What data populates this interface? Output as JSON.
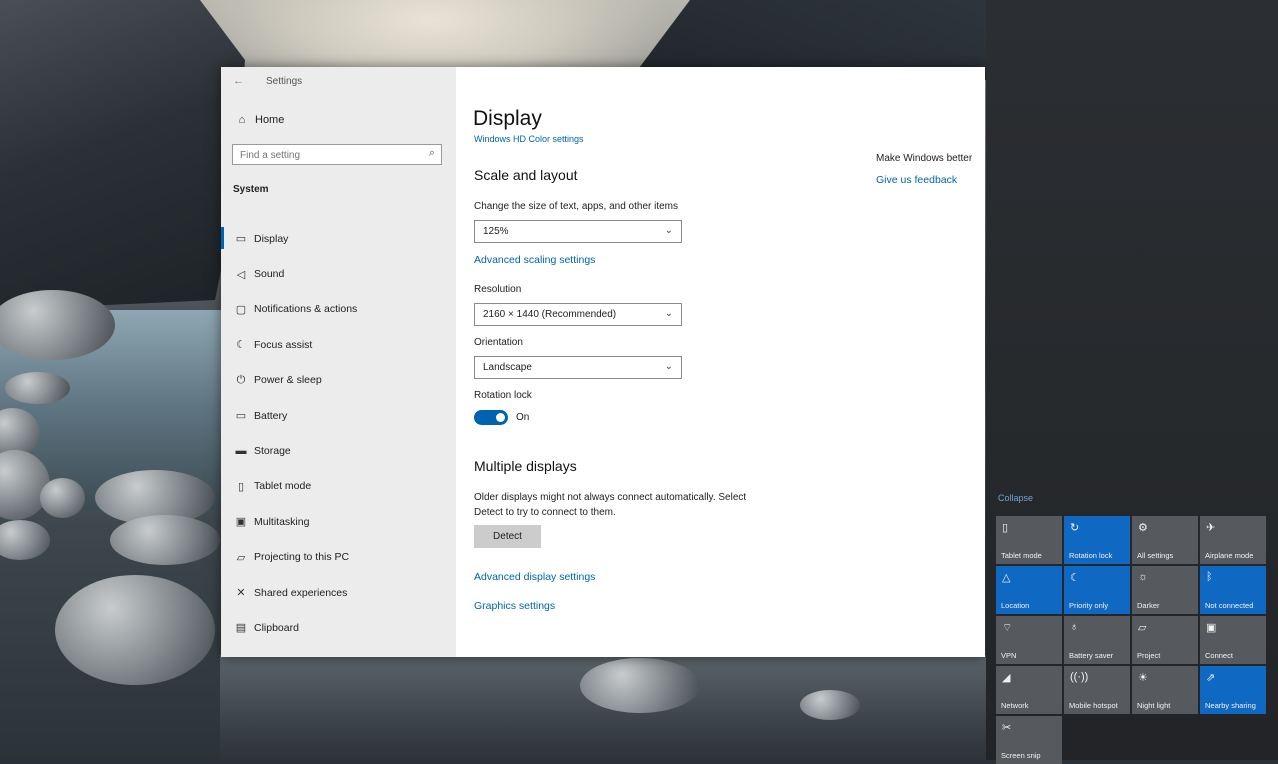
{
  "window": {
    "title": "Settings"
  },
  "sidebar": {
    "home_label": "Home",
    "search_placeholder": "Find a setting",
    "section_label": "System",
    "items": [
      {
        "label": "Display",
        "icon": "monitor-icon"
      },
      {
        "label": "Sound",
        "icon": "speaker-icon"
      },
      {
        "label": "Notifications & actions",
        "icon": "notification-icon"
      },
      {
        "label": "Focus assist",
        "icon": "moon-icon"
      },
      {
        "label": "Power & sleep",
        "icon": "power-icon"
      },
      {
        "label": "Battery",
        "icon": "battery-icon"
      },
      {
        "label": "Storage",
        "icon": "storage-icon"
      },
      {
        "label": "Tablet mode",
        "icon": "tablet-icon"
      },
      {
        "label": "Multitasking",
        "icon": "multitask-icon"
      },
      {
        "label": "Projecting to this PC",
        "icon": "projector-icon"
      },
      {
        "label": "Shared experiences",
        "icon": "shared-icon"
      },
      {
        "label": "Clipboard",
        "icon": "clipboard-icon"
      }
    ]
  },
  "content": {
    "title": "Display",
    "top_link": "Windows HD Color settings",
    "scale": {
      "heading": "Scale and layout",
      "size_label": "Change the size of text, apps, and other items",
      "size_value": "125%",
      "advanced_link": "Advanced scaling settings",
      "resolution_label": "Resolution",
      "resolution_value": "2160 × 1440 (Recommended)",
      "orientation_label": "Orientation",
      "orientation_value": "Landscape",
      "rotation_label": "Rotation lock",
      "rotation_state": "On"
    },
    "multiple": {
      "heading": "Multiple displays",
      "desc_line1": "Older displays might not always connect automatically. Select",
      "desc_line2": "Detect to try to connect to them.",
      "detect_button": "Detect",
      "advanced_display_link": "Advanced display settings",
      "graphics_link": "Graphics settings"
    },
    "side_panel": {
      "text": "Make Windows better",
      "link": "Give us feedback"
    }
  },
  "action_center": {
    "collapse_label": "Collapse",
    "tiles": [
      {
        "label": "Tablet mode",
        "on": false
      },
      {
        "label": "Rotation lock",
        "on": true
      },
      {
        "label": "All settings",
        "on": false
      },
      {
        "label": "Airplane mode",
        "on": false
      },
      {
        "label": "Location",
        "on": true
      },
      {
        "label": "Priority only",
        "on": true
      },
      {
        "label": "Darker",
        "on": false
      },
      {
        "label": "Not connected",
        "on": true
      },
      {
        "label": "VPN",
        "on": false
      },
      {
        "label": "Battery saver",
        "on": false
      },
      {
        "label": "Project",
        "on": false
      },
      {
        "label": "Connect",
        "on": false
      },
      {
        "label": "Network",
        "on": false
      },
      {
        "label": "Mobile hotspot",
        "on": false
      },
      {
        "label": "Night light",
        "on": false
      },
      {
        "label": "Nearby sharing",
        "on": true
      },
      {
        "label": "Screen snip",
        "on": false
      }
    ]
  },
  "colors": {
    "accent": "#0063b1",
    "tile_on": "#0f68c2",
    "tile_off": "#565a5e"
  }
}
